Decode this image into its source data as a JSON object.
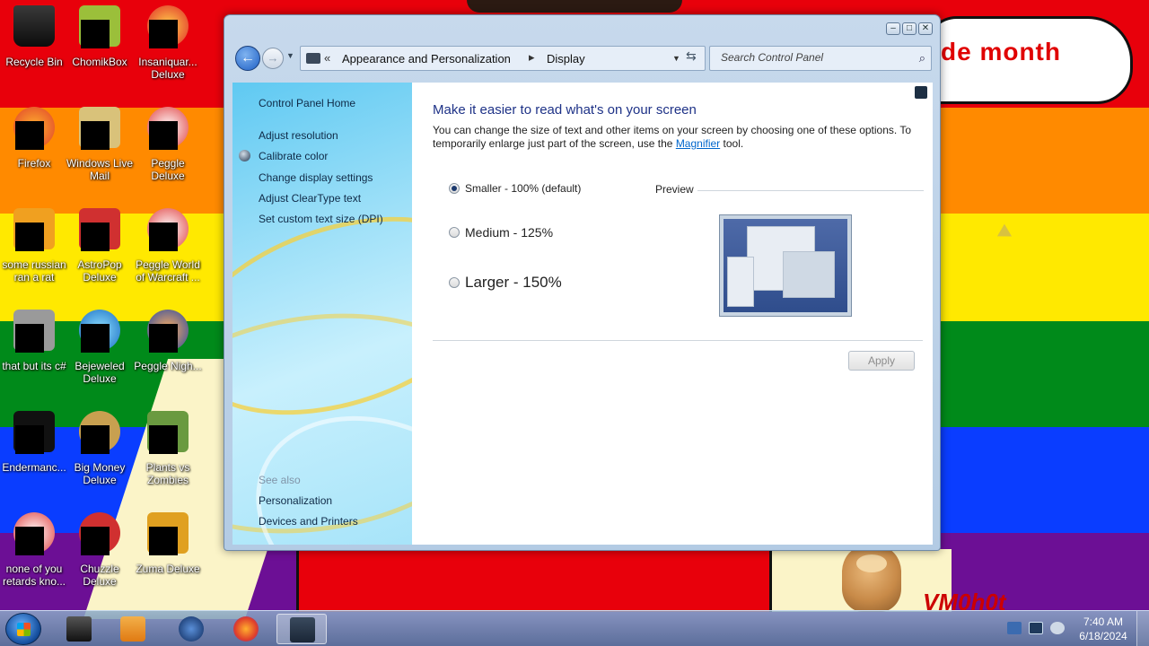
{
  "desktop": {
    "banner_text": "de month",
    "watermark_text": "VM0h0t",
    "icons": [
      {
        "label": "Recycle Bin"
      },
      {
        "label": "ChomikBox"
      },
      {
        "label": "Insaniquar... Deluxe"
      },
      {
        "label": "Firefox"
      },
      {
        "label": "Windows Live Mail"
      },
      {
        "label": "Peggle Deluxe"
      },
      {
        "label": "some russian ran a rat"
      },
      {
        "label": "AstroPop Deluxe"
      },
      {
        "label": "Peggle World of Warcraft ..."
      },
      {
        "label": "that but its c#"
      },
      {
        "label": "Bejeweled Deluxe"
      },
      {
        "label": "Peggle Nigh..."
      },
      {
        "label": "Endermanc..."
      },
      {
        "label": "Big Money Deluxe"
      },
      {
        "label": "Plants vs Zombies"
      },
      {
        "label": "none of you retards kno..."
      },
      {
        "label": "Chuzzle Deluxe"
      },
      {
        "label": "Zuma Deluxe"
      }
    ]
  },
  "window": {
    "address": {
      "crumb1": "Appearance and Personalization",
      "separator": "▸",
      "crumb2": "Display"
    },
    "search_placeholder": "Search Control Panel",
    "sidebar": {
      "home": "Control Panel Home",
      "links": [
        "Adjust resolution",
        "Calibrate color",
        "Change display settings",
        "Adjust ClearType text",
        "Set custom text size (DPI)"
      ],
      "see_also_label": "See also",
      "see_also": [
        "Personalization",
        "Devices and Printers"
      ]
    },
    "main": {
      "heading": "Make it easier to read what's on your screen",
      "desc_before": "You can change the size of text and other items on your screen by choosing one of these options. To temporarily enlarge just part of the screen, use the ",
      "desc_link": "Magnifier",
      "desc_after": " tool.",
      "options": [
        {
          "label": "Smaller - 100% (default)",
          "checked": true
        },
        {
          "label": "Medium - 125%",
          "checked": false
        },
        {
          "label": "Larger - 150%",
          "checked": false
        }
      ],
      "preview_label": "Preview",
      "apply_label": "Apply"
    }
  },
  "taskbar": {
    "time": "7:40 AM",
    "date": "6/18/2024"
  }
}
